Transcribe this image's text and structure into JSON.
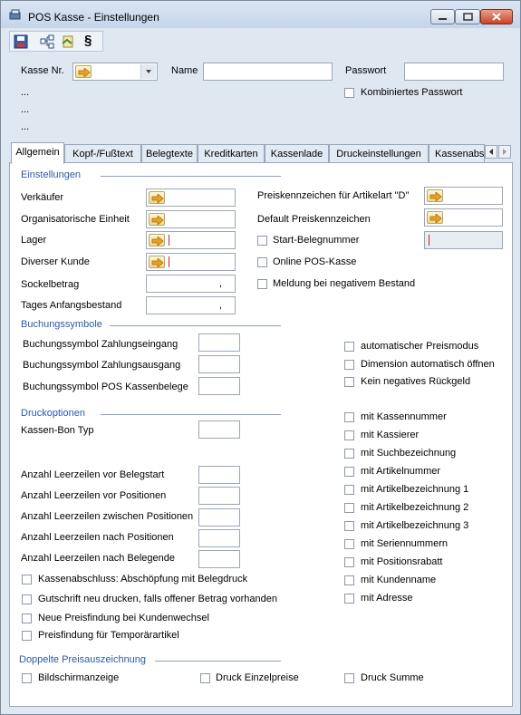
{
  "window": {
    "title": "POS Kasse - Einstellungen"
  },
  "toolbar": {
    "icons": [
      "save-icon",
      "tree-icon",
      "link-icon",
      "paragraph-icon"
    ],
    "paragraph_glyph": "§"
  },
  "header": {
    "kasse_nr_label": "Kasse Nr.",
    "kasse_nr_value": "",
    "name_label": "Name",
    "name_value": "",
    "passwort_label": "Passwort",
    "passwort_value": "",
    "kombiniertes_passwort": "Kombiniertes Passwort",
    "ellipsis": [
      "...",
      "...",
      "..."
    ]
  },
  "tabs": [
    "Allgemein",
    "Kopf-/Fußtext",
    "Belegtexte",
    "Kreditkarten",
    "Kassenlade",
    "Druckeinstellungen",
    "Kassenabs"
  ],
  "active_tab": "Allgemein",
  "einstellungen": {
    "title": "Einstellungen",
    "verkaeufer": "Verkäufer",
    "org_einheit": "Organisatorische Einheit",
    "lager": "Lager",
    "diverser_kunde": "Diverser Kunde",
    "sockelbetrag": "Sockelbetrag",
    "sockelbetrag_value": ",",
    "tages_anfangsbestand": "Tages Anfangsbestand",
    "tages_anfangsbestand_value": ",",
    "preiskennzeichen_artikelart": "Preiskennzeichen für Artikelart \"D\"",
    "default_preiskennzeichen": "Default Preiskennzeichen",
    "start_belegnummer": "Start-Belegnummer",
    "online_pos_kasse": "Online POS-Kasse",
    "meldung_negativ": "Meldung bei negativem Bestand"
  },
  "buchungssymbole": {
    "title": "Buchungssymbole",
    "zahlungseingang": "Buchungssymbol Zahlungseingang",
    "zahlungsausgang": "Buchungssymbol Zahlungsausgang",
    "pos_kassenbelege": "Buchungssymbol POS Kassenbelege",
    "auto_preismodus": "automatischer Preismodus",
    "dimension_auto": "Dimension automatisch öffnen",
    "kein_negatives_rueckgeld": "Kein negatives Rückgeld"
  },
  "druckoptionen": {
    "title": "Druckoptionen",
    "kassen_bon_typ": "Kassen-Bon Typ",
    "leer_vor_belegstart": "Anzahl Leerzeilen vor Belegstart",
    "leer_vor_positionen": "Anzahl Leerzeilen vor Positionen",
    "leer_zwischen_positionen": "Anzahl Leerzeilen zwischen Positionen",
    "leer_nach_positionen": "Anzahl Leerzeilen nach Positionen",
    "leer_nach_belegende": "Anzahl Leerzeilen nach Belegende",
    "kassenabschluss": "Kassenabschluss: Abschöpfung mit Belegdruck",
    "gutschrift": "Gutschrift neu drucken, falls offener Betrag vorhanden",
    "neue_preisfindung": "Neue Preisfindung bei Kundenwechsel",
    "preisfindung_temp": "Preisfindung für Temporärartikel",
    "right_options": [
      "mit Kassennummer",
      "mit Kassierer",
      "mit Suchbezeichnung",
      "mit Artikelnummer",
      "mit Artikelbezeichnung 1",
      "mit Artikelbezeichnung 2",
      "mit Artikelbezeichnung 3",
      "mit Seriennummern",
      "mit Positionsrabatt",
      "mit Kundenname",
      "mit Adresse"
    ]
  },
  "doppelte": {
    "title": "Doppelte Preisauszeichnung",
    "bildschirmanzeige": "Bildschirmanzeige",
    "druck_einzelpreise": "Druck Einzelpreise",
    "druck_summe": "Druck Summe"
  }
}
